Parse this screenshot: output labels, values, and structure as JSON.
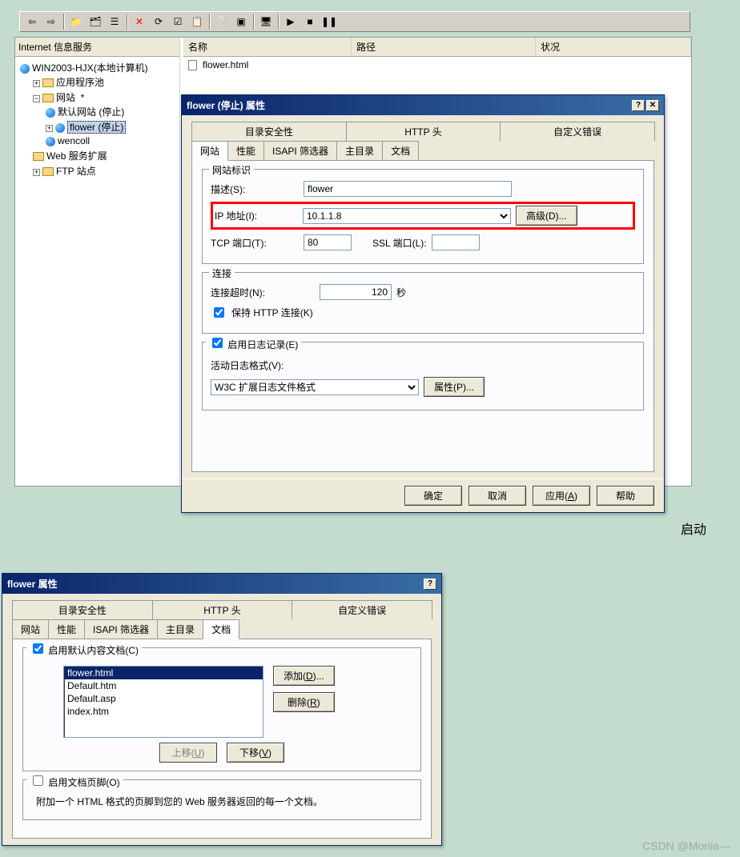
{
  "toolbar_icons": [
    "back",
    "forward",
    "up",
    "folder-tree",
    "list-view",
    "delete",
    "refresh",
    "properties",
    "copy",
    "help",
    "computer",
    "play",
    "stop",
    "pause"
  ],
  "tree": {
    "header": "Internet 信息服务",
    "root": "WIN2003-HJX(本地计算机)",
    "app_pool": "应用程序池",
    "websites": "网站",
    "star": "*",
    "default_site": "默认网站 (停止)",
    "flower_site": "flower (停止)",
    "wencoll": "wencoll",
    "web_ext": "Web 服务扩展",
    "ftp": "FTP 站点"
  },
  "list": {
    "col1": "名称",
    "col2": "路径",
    "col3": "状况",
    "item1": "flower.html"
  },
  "dialog1": {
    "title": "flower (停止) 属性",
    "tabs_row1": [
      "目录安全性",
      "HTTP 头",
      "自定义错误"
    ],
    "tabs_row2": [
      "网站",
      "性能",
      "ISAPI 筛选器",
      "主目录",
      "文档"
    ],
    "active_tab": "网站",
    "fs_site": "网站标识",
    "lbl_desc": "描述(S):",
    "val_desc": "flower",
    "lbl_ip": "IP 地址(I):",
    "val_ip": "10.1.1.8",
    "btn_adv": "高级(D)...",
    "lbl_tcp": "TCP 端口(T):",
    "val_tcp": "80",
    "lbl_ssl": "SSL 端口(L):",
    "fs_conn": "连接",
    "lbl_timeout": "连接超时(N):",
    "val_timeout": "120",
    "lbl_sec": "秒",
    "chk_keep": "保持 HTTP 连接(K)",
    "chk_log": "启用日志记录(E)",
    "lbl_logfmt": "活动日志格式(V):",
    "val_logfmt": "W3C 扩展日志文件格式",
    "btn_logprop": "属性(P)...",
    "btn_ok": "确定",
    "btn_cancel": "取消",
    "btn_apply": "应用(A)",
    "btn_help": "帮助"
  },
  "dialog2": {
    "title": "flower 属性",
    "tabs_row1": [
      "目录安全性",
      "HTTP 头",
      "自定义错误"
    ],
    "tabs_row2": [
      "网站",
      "性能",
      "ISAPI 筛选器",
      "主目录",
      "文档"
    ],
    "active_tab": "文档",
    "chk_default": "启用默认内容文档(C)",
    "docs": [
      "flower.html",
      "Default.htm",
      "Default.asp",
      "index.htm"
    ],
    "btn_add": "添加(D)...",
    "btn_del": "删除(R)",
    "btn_up": "上移(U)",
    "btn_down": "下移(V)",
    "chk_footer": "启用文档页脚(O)",
    "footer_hint": "附加一个 HTML 格式的页脚到您的 Web 服务器返回的每一个文档。"
  },
  "start_label": "启动",
  "watermark": "CSDN @Moriia---"
}
